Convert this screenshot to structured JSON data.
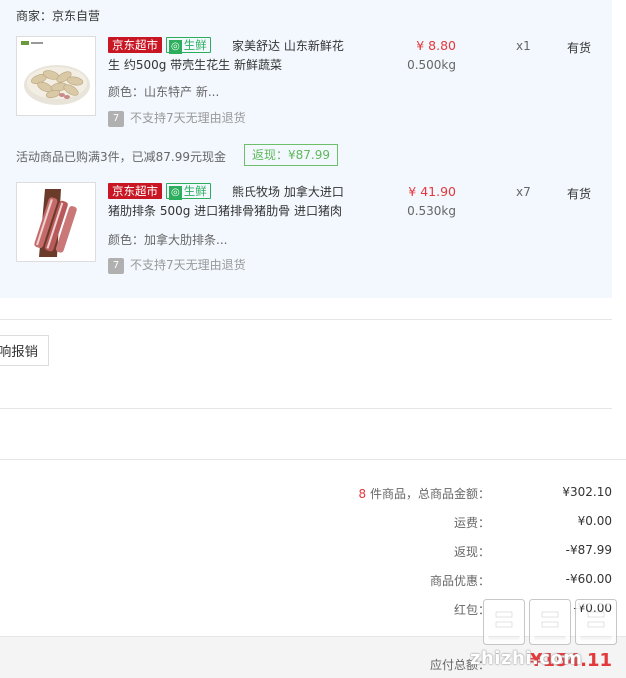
{
  "seller_label": "商家：京东自营",
  "items": [
    {
      "tag_jd": "京东超市",
      "tag_fresh": "生鲜",
      "title": "家美舒达 山东新鲜花生 约500g 带壳生花生 新鲜蔬菜",
      "variant": "颜色：山东特产 新...",
      "service": "不支持7天无理由退货",
      "service_icon": "7",
      "price": "¥ 8.80",
      "weight": "0.500kg",
      "qty": "x1",
      "stock": "有货"
    },
    {
      "tag_jd": "京东超市",
      "tag_fresh": "生鲜",
      "title": "熊氏牧场 加拿大进口猪肋排条 500g 进口猪排骨猪肋骨 进口猪肉",
      "variant": "颜色：加拿大肋排条...",
      "service": "不支持7天无理由退货",
      "service_icon": "7",
      "price": "¥ 41.90",
      "weight": "0.530kg",
      "qty": "x7",
      "stock": "有货"
    }
  ],
  "promo_text": "活动商品已购满3件，已减87.99元现金",
  "cashback_label": "返现：¥87.99",
  "invoice_button": "响报销",
  "summary": {
    "count": "8",
    "goods_label": " 件商品，总商品金额：",
    "goods_value": "¥302.10",
    "shipping_label": "运费：",
    "shipping_value": "¥0.00",
    "cashback_label": "返现：",
    "cashback_value": "-¥87.99",
    "discount_label": "商品优惠：",
    "discount_value": "-¥60.00",
    "redpacket_label": "红包：",
    "redpacket_value": "-¥0.00"
  },
  "total_label": "应付总额：",
  "total_value": "¥154.11",
  "watermark_text": "zhizhi.com"
}
